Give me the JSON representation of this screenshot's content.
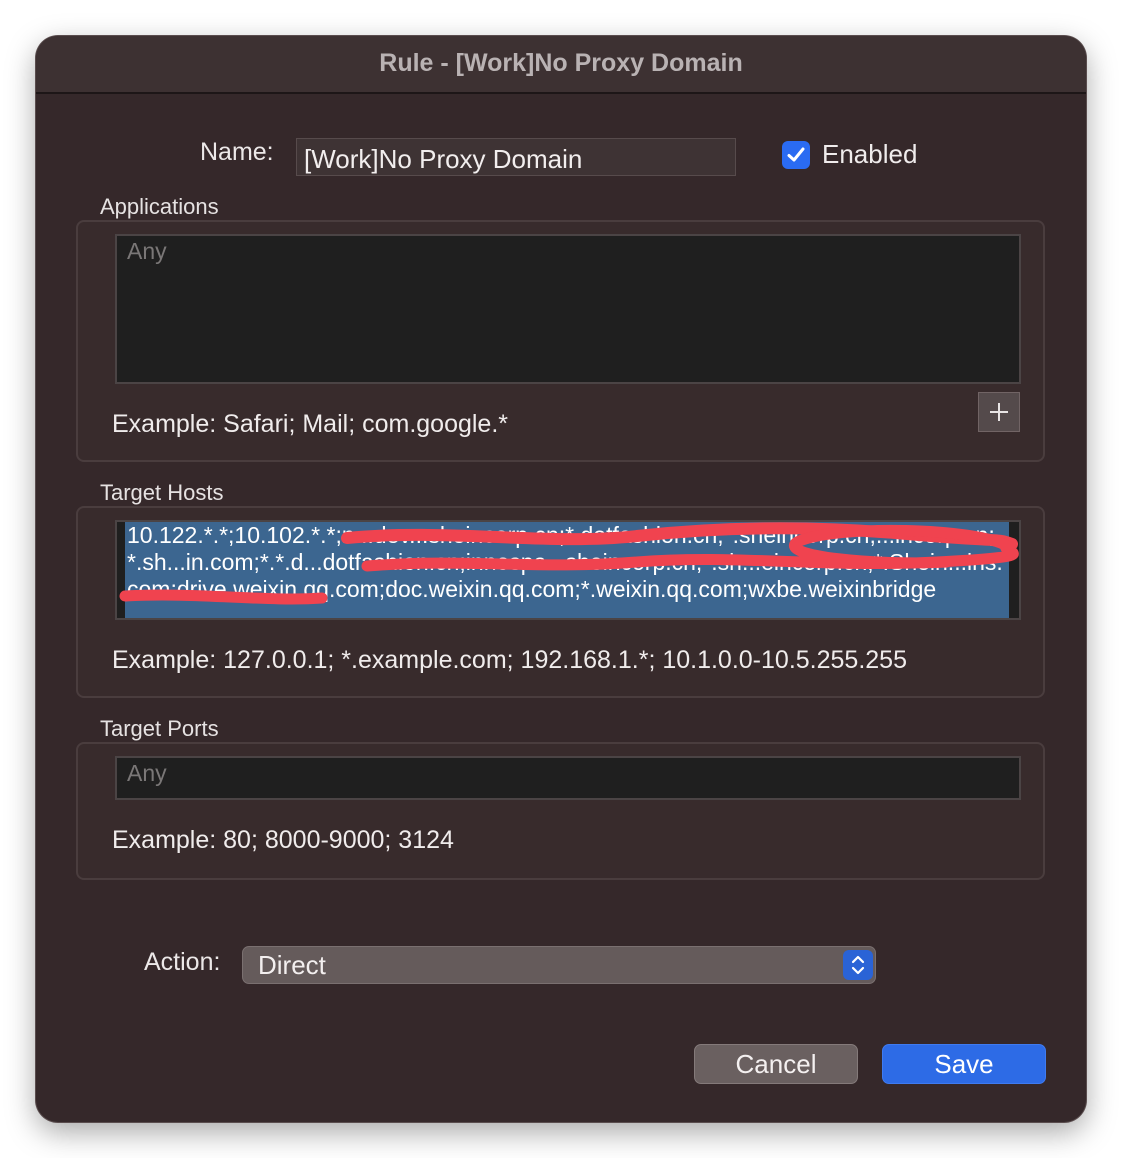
{
  "window": {
    "title": "Rule - [Work]No Proxy Domain"
  },
  "name": {
    "label": "Name:",
    "value": "[Work]No Proxy Domain"
  },
  "enabled": {
    "label": "Enabled",
    "checked": true
  },
  "applications": {
    "title": "Applications",
    "placeholder": "Any",
    "example": "Example: Safari; Mail; com.google.*",
    "add_icon": "plus-icon"
  },
  "target_hosts": {
    "title": "Target Hosts",
    "value": "10.122.*.*;10.102.*.*;n...dev...sheincorp.cn;*.dotfashion.cn;*.sheincorp.cn;...incorp.cn;*.sh...in.com;*.*.d...dotfashion.cn;innospa...sheincorp.cn;*.sh...eincorp.cn;*.Shein...ins.com;drive.weixin.qq.com;doc.weixin.qq.com;*.weixin.qq.com;wxbe.weixinbridge",
    "example": "Example: 127.0.0.1; *.example.com; 192.168.1.*; 10.1.0.0-10.5.255.255"
  },
  "target_ports": {
    "title": "Target Ports",
    "placeholder": "Any",
    "example": "Example: 80; 8000-9000; 3124"
  },
  "action": {
    "label": "Action:",
    "value": "Direct"
  },
  "buttons": {
    "cancel": "Cancel",
    "save": "Save"
  },
  "colors": {
    "accent": "#2d6be6",
    "selection": "#3c6690",
    "redaction": "#f0434f"
  }
}
